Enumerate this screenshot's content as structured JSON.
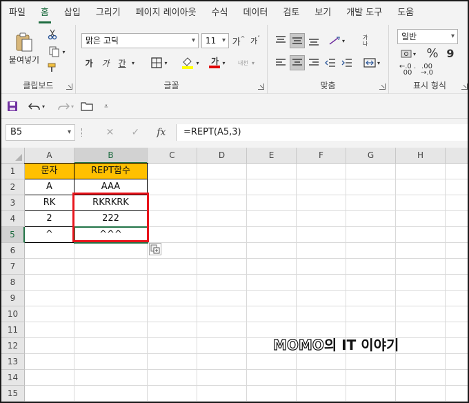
{
  "menu": {
    "tabs": [
      "파일",
      "홈",
      "삽입",
      "그리기",
      "페이지 레이아웃",
      "수식",
      "데이터",
      "검토",
      "보기",
      "개발 도구",
      "도움"
    ],
    "active_index": 1
  },
  "ribbon": {
    "clipboard": {
      "paste_label": "붙여넣기",
      "group_label": "클립보드"
    },
    "font": {
      "font_name": "맑은 고딕",
      "font_size": "11",
      "grow_label": "가",
      "bold": "가",
      "italic": "가",
      "underline": "간",
      "font_color_glyph": "가",
      "phonetic": "내천",
      "group_label": "글꼴"
    },
    "alignment": {
      "wrap_label": "가나",
      "group_label": "맞춤"
    },
    "number": {
      "format": "일반",
      "percent": "%",
      "comma": "9",
      "dec_inc": "←.0 .00",
      "dec_dec": ".00 →.0",
      "group_label": "표시 형식"
    }
  },
  "formula_bar": {
    "name_box": "B5",
    "fx": "fx",
    "formula": "=REPT(A5,3)"
  },
  "sheet": {
    "columns": [
      "A",
      "B",
      "C",
      "D",
      "E",
      "F",
      "G",
      "H"
    ],
    "selected_column": "B",
    "rows": [
      "1",
      "2",
      "3",
      "4",
      "5",
      "6",
      "7",
      "8",
      "9",
      "10",
      "11",
      "12",
      "13",
      "14",
      "15"
    ],
    "selected_row": "5",
    "cells": {
      "A1": "문자",
      "B1": "REPT함수",
      "A2": "A",
      "B2": "AAA",
      "A3": "RK",
      "B3": "RKRKRK",
      "A4": "2",
      "B4": "222",
      "A5": "^",
      "B5": "^^^"
    },
    "header_fill": "#ffc000",
    "highlight_color": "#e8141b",
    "selection_color": "#217346"
  },
  "watermark": {
    "latin_part": "MOMO",
    "rest": "의 IT 이야기"
  }
}
